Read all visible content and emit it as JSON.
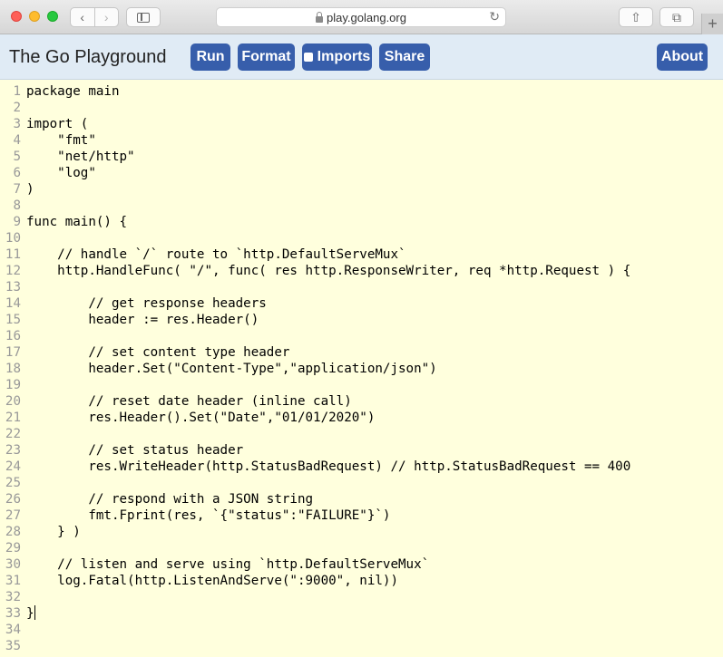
{
  "browser": {
    "url": "play.golang.org",
    "back_glyph": "‹",
    "forward_glyph": "›",
    "reload_glyph": "↻",
    "share_glyph": "⇧",
    "tabs_glyph": "⧉",
    "new_tab_glyph": "+"
  },
  "header": {
    "title": "The Go Playground",
    "run_label": "Run",
    "format_label": "Format",
    "imports_label": "Imports",
    "share_label": "Share",
    "about_label": "About",
    "accent_color": "#375eab",
    "background_color": "#e0ebf5"
  },
  "editor": {
    "background_color": "#ffffdd",
    "lines": [
      {
        "num": "1",
        "text": "package main"
      },
      {
        "num": "2",
        "text": ""
      },
      {
        "num": "3",
        "text": "import ("
      },
      {
        "num": "4",
        "text": "    \"fmt\""
      },
      {
        "num": "5",
        "text": "    \"net/http\""
      },
      {
        "num": "6",
        "text": "    \"log\""
      },
      {
        "num": "7",
        "text": ")"
      },
      {
        "num": "8",
        "text": ""
      },
      {
        "num": "9",
        "text": "func main() {"
      },
      {
        "num": "10",
        "text": ""
      },
      {
        "num": "11",
        "text": "    // handle `/` route to `http.DefaultServeMux`"
      },
      {
        "num": "12",
        "text": "    http.HandleFunc( \"/\", func( res http.ResponseWriter, req *http.Request ) {"
      },
      {
        "num": "13",
        "text": ""
      },
      {
        "num": "14",
        "text": "        // get response headers"
      },
      {
        "num": "15",
        "text": "        header := res.Header()"
      },
      {
        "num": "16",
        "text": ""
      },
      {
        "num": "17",
        "text": "        // set content type header"
      },
      {
        "num": "18",
        "text": "        header.Set(\"Content-Type\",\"application/json\")"
      },
      {
        "num": "19",
        "text": ""
      },
      {
        "num": "20",
        "text": "        // reset date header (inline call)"
      },
      {
        "num": "21",
        "text": "        res.Header().Set(\"Date\",\"01/01/2020\")"
      },
      {
        "num": "22",
        "text": ""
      },
      {
        "num": "23",
        "text": "        // set status header"
      },
      {
        "num": "24",
        "text": "        res.WriteHeader(http.StatusBadRequest) // http.StatusBadRequest == 400"
      },
      {
        "num": "25",
        "text": ""
      },
      {
        "num": "26",
        "text": "        // respond with a JSON string"
      },
      {
        "num": "27",
        "text": "        fmt.Fprint(res, `{\"status\":\"FAILURE\"}`)"
      },
      {
        "num": "28",
        "text": "    } )"
      },
      {
        "num": "29",
        "text": ""
      },
      {
        "num": "30",
        "text": "    // listen and serve using `http.DefaultServeMux`"
      },
      {
        "num": "31",
        "text": "    log.Fatal(http.ListenAndServe(\":9000\", nil))"
      },
      {
        "num": "32",
        "text": ""
      },
      {
        "num": "33",
        "text": "}"
      },
      {
        "num": "34",
        "text": ""
      },
      {
        "num": "35",
        "text": ""
      }
    ]
  }
}
